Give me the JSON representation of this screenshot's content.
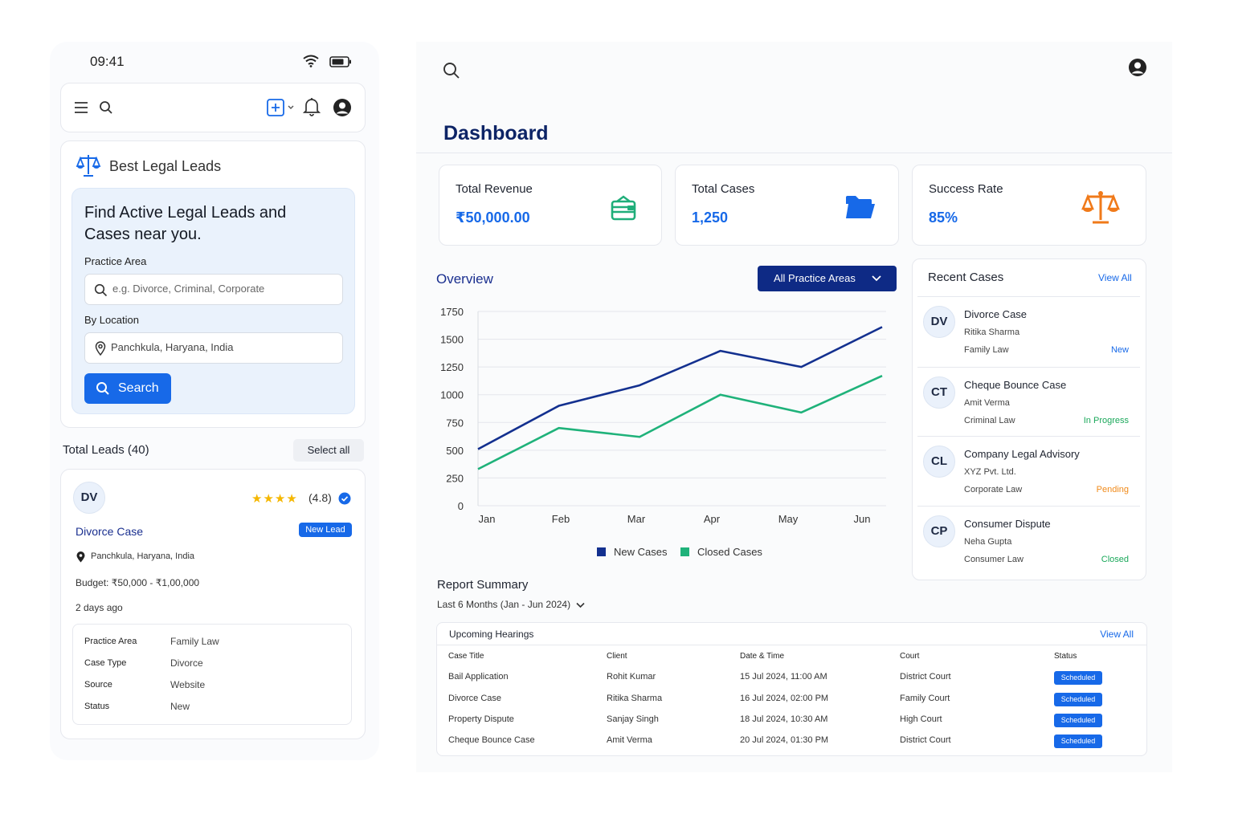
{
  "mobile": {
    "time": "09:41",
    "brand": "Best Legal Leads",
    "hero_title": "Find Active Legal Leads and Cases near you.",
    "practice_label": "Practice Area",
    "practice_placeholder": "e.g. Divorce, Criminal, Corporate",
    "location_label": "By Location",
    "location_value": "Panchkula, Haryana, India",
    "search_label": "Search",
    "leads_title": "Total Leads (40)",
    "select_all": "Select all",
    "lead": {
      "initials": "DV",
      "stars": "★★★★",
      "rating": "(4.8)",
      "title": "Divorce Case",
      "badge": "New Lead",
      "location": "Panchkula, Haryana, India",
      "budget": "Budget: ₹50,000 - ₹1,00,000",
      "posted": "2 days ago",
      "details": [
        {
          "k": "Practice Area",
          "v": "Family Law"
        },
        {
          "k": "Case Type",
          "v": "Divorce"
        },
        {
          "k": "Source",
          "v": "Website"
        },
        {
          "k": "Status",
          "v": "New"
        }
      ]
    }
  },
  "dashboard": {
    "title": "Dashboard",
    "stats": [
      {
        "label": "Total Revenue",
        "value": "₹50,000.00",
        "icon": "wallet-icon",
        "color": "#1fae7a"
      },
      {
        "label": "Total Cases",
        "value": "1,250",
        "icon": "folder-icon",
        "color": "#1769e8"
      },
      {
        "label": "Success Rate",
        "value": "85%",
        "icon": "scales-icon",
        "color": "#f07a1a"
      }
    ],
    "overview_title": "Overview",
    "practice_filter": "All Practice Areas",
    "recent": {
      "title": "Recent Cases",
      "view_all": "View All",
      "items": [
        {
          "initials": "DV",
          "name": "Divorce Case",
          "client": "Ritika Sharma",
          "area": "Family Law",
          "status": "New",
          "color": "#1769e8"
        },
        {
          "initials": "CT",
          "name": "Cheque Bounce Case",
          "client": "Amit Verma",
          "area": "Criminal Law",
          "status": "In Progress",
          "color": "#1aa85a"
        },
        {
          "initials": "CL",
          "name": "Company Legal Advisory",
          "client": "XYZ Pvt. Ltd.",
          "area": "Corporate Law",
          "status": "Pending",
          "color": "#f08a1a"
        },
        {
          "initials": "CP",
          "name": "Consumer Dispute",
          "client": "Neha Gupta",
          "area": "Consumer Law",
          "status": "Closed",
          "color": "#1aa85a"
        }
      ]
    },
    "report": {
      "title": "Report Summary",
      "range": "Last 6 Months (Jan - Jun 2024)"
    },
    "hearings": {
      "title": "Upcoming Hearings",
      "view_all": "View All",
      "columns": [
        "Case Title",
        "Client",
        "Date & Time",
        "Court",
        "Status"
      ],
      "rows": [
        [
          "Bail Application",
          "Rohit Kumar",
          "15 Jul 2024, 11:00 AM",
          "District Court",
          "Scheduled"
        ],
        [
          "Divorce Case",
          "Ritika Sharma",
          "16 Jul 2024, 02:00 PM",
          "Family Court",
          "Scheduled"
        ],
        [
          "Property Dispute",
          "Sanjay Singh",
          "18 Jul 2024, 10:30 AM",
          "High Court",
          "Scheduled"
        ],
        [
          "Cheque Bounce Case",
          "Amit Verma",
          "20 Jul 2024, 01:30 PM",
          "District Court",
          "Scheduled"
        ]
      ]
    }
  },
  "chart_data": {
    "type": "line",
    "categories": [
      "Jan",
      "Feb",
      "Mar",
      "Apr",
      "May",
      "Jun"
    ],
    "ylim": [
      0,
      1750
    ],
    "yticks": [
      1750,
      1500,
      1250,
      1000,
      750,
      500,
      250,
      0
    ],
    "grid": true,
    "legend": "bottom",
    "series": [
      {
        "name": "New Cases",
        "color": "#13308f",
        "values": [
          510,
          900,
          1085,
          1395,
          1250,
          1610
        ]
      },
      {
        "name": "Closed Cases",
        "color": "#1fb27a",
        "values": [
          330,
          700,
          620,
          1000,
          840,
          1170
        ]
      }
    ]
  }
}
